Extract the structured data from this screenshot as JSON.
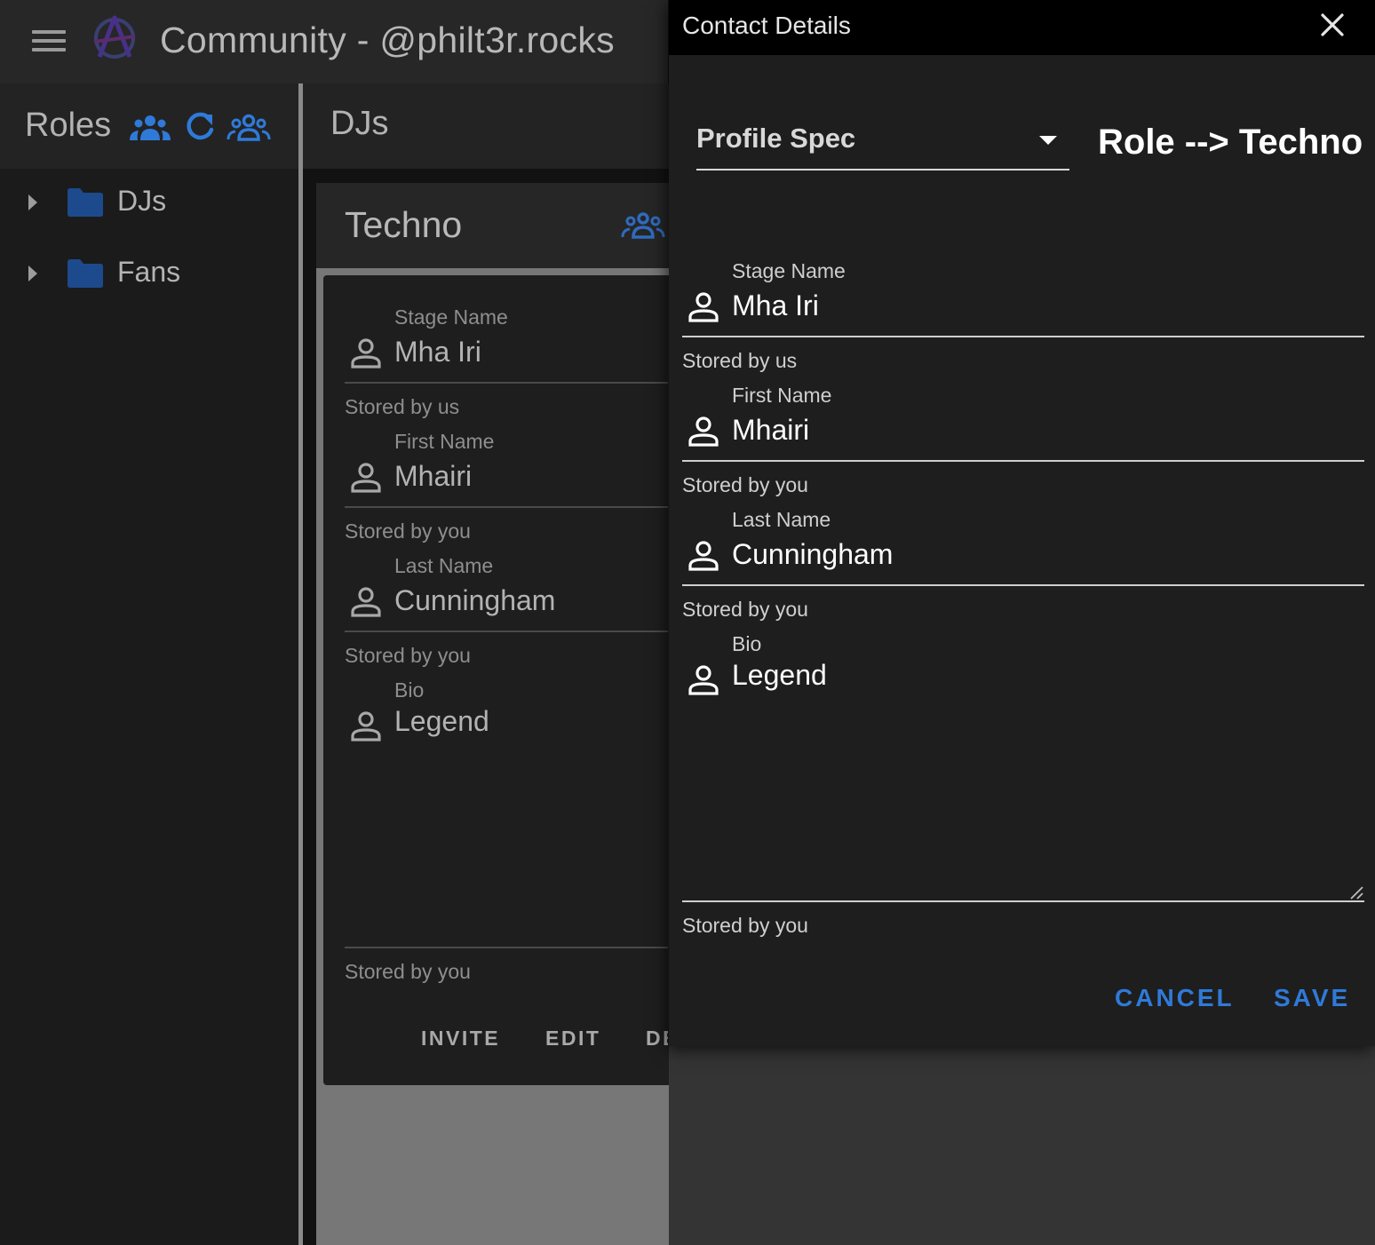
{
  "appbar": {
    "title": "Community - @philt3r.rocks"
  },
  "sidebar": {
    "title": "Roles",
    "items": [
      {
        "label": "DJs"
      },
      {
        "label": "Fans"
      }
    ]
  },
  "main": {
    "title": "DJs",
    "card": {
      "title": "Techno",
      "fields": [
        {
          "label": "Stage Name",
          "value": "Mha Iri",
          "hint": "Stored by us"
        },
        {
          "label": "First Name",
          "value": "Mhairi",
          "hint": "Stored by you"
        },
        {
          "label": "Last Name",
          "value": "Cunningham",
          "hint": "Stored by you"
        },
        {
          "label": "Bio",
          "value": "Legend",
          "hint": "Stored by you"
        }
      ],
      "actions": {
        "invite": "INVITE",
        "edit": "EDIT",
        "delete_partial": "DE"
      }
    }
  },
  "dialog": {
    "title": "Contact Details",
    "profile_select": {
      "label": "Profile Spec"
    },
    "role_heading": "Role --> Techno",
    "fields": [
      {
        "label": "Stage Name",
        "value": "Mha Iri",
        "hint": "Stored by us"
      },
      {
        "label": "First Name",
        "value": "Mhairi",
        "hint": "Stored by you"
      },
      {
        "label": "Last Name",
        "value": "Cunningham",
        "hint": "Stored by you"
      },
      {
        "label": "Bio",
        "value": "Legend",
        "hint": "Stored by you"
      }
    ],
    "buttons": {
      "cancel": "CANCEL",
      "save": "SAVE"
    }
  },
  "colors": {
    "accent": "#2f7ad9",
    "folder": "#1d4a8c",
    "dialog_bg": "#1e1e1e",
    "app_bg": "#121212"
  },
  "icons": [
    "menu-icon",
    "anarchy-logo-icon",
    "people-icon",
    "refresh-icon",
    "people-outline-icon",
    "folder-icon",
    "person-icon",
    "close-icon",
    "dropdown-caret-icon",
    "resize-grip-icon"
  ]
}
